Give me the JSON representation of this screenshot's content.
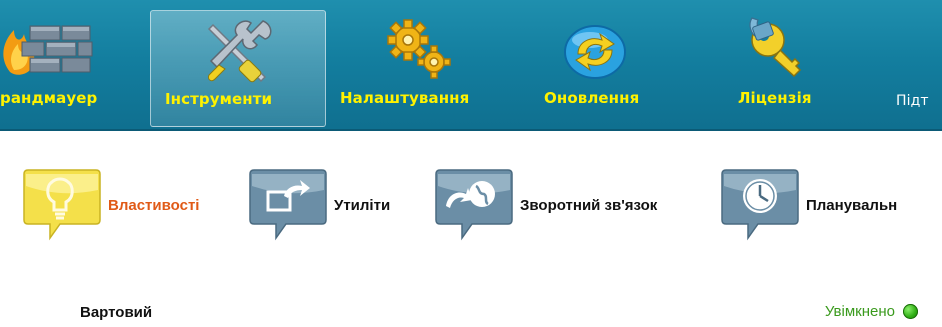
{
  "toolbar": {
    "items": [
      {
        "label": "рандмауер",
        "icon": "firewall-icon"
      },
      {
        "label": "Інструменти",
        "icon": "tools-icon",
        "active": true
      },
      {
        "label": "Налаштування",
        "icon": "gears-icon"
      },
      {
        "label": "Оновлення",
        "icon": "refresh-icon"
      },
      {
        "label": "Ліцензія",
        "icon": "key-icon"
      },
      {
        "label": "Підт",
        "icon": ""
      }
    ]
  },
  "subtabs": [
    {
      "label": "Властивості",
      "icon": "lightbulb-icon",
      "active": true
    },
    {
      "label": "Утиліти",
      "icon": "export-icon"
    },
    {
      "label": "Зворотний зв'язок",
      "icon": "feedback-globe-icon"
    },
    {
      "label": "Планувальн",
      "icon": "clock-icon"
    }
  ],
  "setting_row": {
    "label": "Вартовий",
    "status": "Увімкнено",
    "status_color": "#3a9a1d"
  },
  "colors": {
    "toolbar_bg": "#137e9f",
    "toolbar_label": "#fff200",
    "active_subtab_label": "#e05a17"
  }
}
